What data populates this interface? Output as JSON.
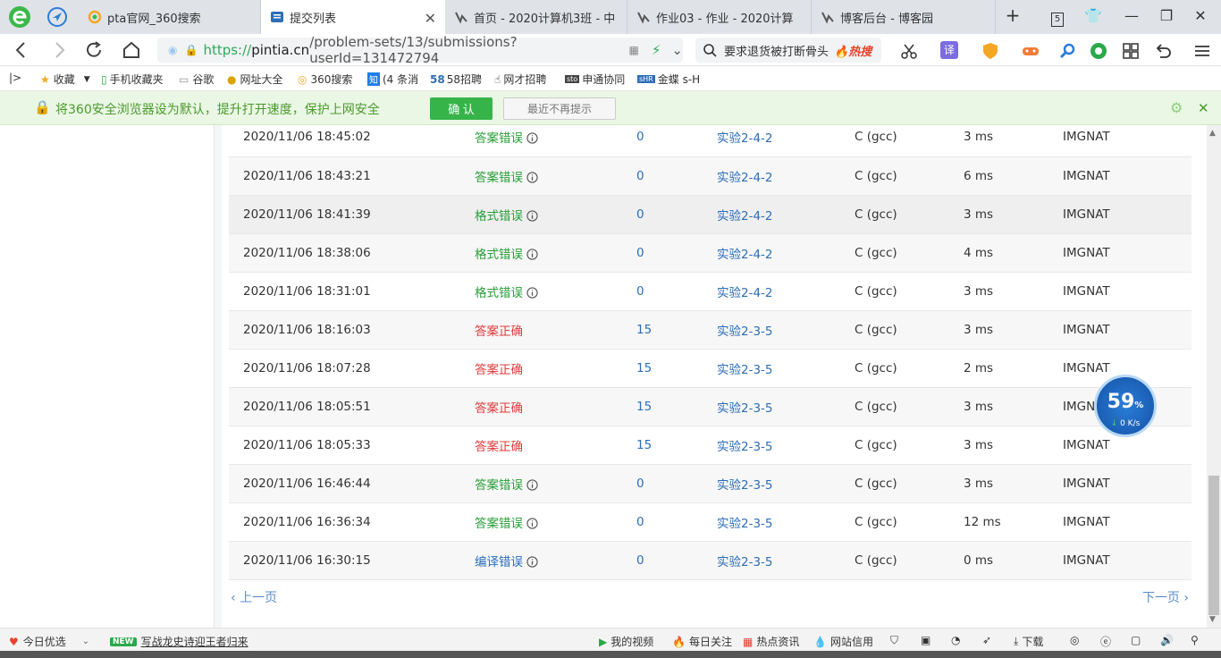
{
  "tabs": [
    {
      "title": "pta官网_360搜索",
      "active": false
    },
    {
      "title": "提交列表",
      "active": true
    },
    {
      "title": "首页 - 2020计算机3班 - 中",
      "active": false
    },
    {
      "title": "作业03 - 作业 - 2020计算",
      "active": false
    },
    {
      "title": "博客后台 - 博客园",
      "active": false
    }
  ],
  "tab_count": "5",
  "address": {
    "scheme": "https://",
    "host": "pintia.cn",
    "path": "/problem-sets/13/submissions?userId=131472794"
  },
  "search": {
    "text": "要求退货被打断骨头",
    "hot_label": "热搜"
  },
  "toolbar": {
    "translate_label": "译"
  },
  "bookmarks": [
    {
      "label": "收藏"
    },
    {
      "label": "手机收藏夹"
    },
    {
      "label": "谷歌"
    },
    {
      "label": "网址大全"
    },
    {
      "label": "360搜索"
    },
    {
      "label": "(4 条消"
    },
    {
      "label": "58招聘"
    },
    {
      "label": "网才招聘"
    },
    {
      "label": "申通协同"
    },
    {
      "label": "金蝶 s-H"
    }
  ],
  "notice": {
    "message": "将360安全浏览器设为默认，提升打开速度，保护上网安全",
    "confirm_label": "确 认",
    "dismiss_label": "最近不再提示"
  },
  "submissions": [
    {
      "time": "2020/11/06 18:45:02",
      "status": "答案错误",
      "status_kind": "wrong",
      "score": "0",
      "problem": "实验2-4-2",
      "compiler": "C (gcc)",
      "runtime": "3 ms",
      "user": "IMGNAT"
    },
    {
      "time": "2020/11/06 18:43:21",
      "status": "答案错误",
      "status_kind": "wrong",
      "score": "0",
      "problem": "实验2-4-2",
      "compiler": "C (gcc)",
      "runtime": "6 ms",
      "user": "IMGNAT"
    },
    {
      "time": "2020/11/06 18:41:39",
      "status": "格式错误",
      "status_kind": "format",
      "score": "0",
      "problem": "实验2-4-2",
      "compiler": "C (gcc)",
      "runtime": "3 ms",
      "user": "IMGNAT"
    },
    {
      "time": "2020/11/06 18:38:06",
      "status": "格式错误",
      "status_kind": "format",
      "score": "0",
      "problem": "实验2-4-2",
      "compiler": "C (gcc)",
      "runtime": "4 ms",
      "user": "IMGNAT"
    },
    {
      "time": "2020/11/06 18:31:01",
      "status": "格式错误",
      "status_kind": "format",
      "score": "0",
      "problem": "实验2-4-2",
      "compiler": "C (gcc)",
      "runtime": "3 ms",
      "user": "IMGNAT"
    },
    {
      "time": "2020/11/06 18:16:03",
      "status": "答案正确",
      "status_kind": "correct",
      "score": "15",
      "problem": "实验2-3-5",
      "compiler": "C (gcc)",
      "runtime": "3 ms",
      "user": "IMGNAT"
    },
    {
      "time": "2020/11/06 18:07:28",
      "status": "答案正确",
      "status_kind": "correct",
      "score": "15",
      "problem": "实验2-3-5",
      "compiler": "C (gcc)",
      "runtime": "2 ms",
      "user": "IMGNAT"
    },
    {
      "time": "2020/11/06 18:05:51",
      "status": "答案正确",
      "status_kind": "correct",
      "score": "15",
      "problem": "实验2-3-5",
      "compiler": "C (gcc)",
      "runtime": "3 ms",
      "user": "IMGNAT"
    },
    {
      "time": "2020/11/06 18:05:33",
      "status": "答案正确",
      "status_kind": "correct",
      "score": "15",
      "problem": "实验2-3-5",
      "compiler": "C (gcc)",
      "runtime": "3 ms",
      "user": "IMGNAT"
    },
    {
      "time": "2020/11/06 16:46:44",
      "status": "答案错误",
      "status_kind": "wrong",
      "score": "0",
      "problem": "实验2-3-5",
      "compiler": "C (gcc)",
      "runtime": "3 ms",
      "user": "IMGNAT"
    },
    {
      "time": "2020/11/06 16:36:34",
      "status": "答案错误",
      "status_kind": "wrong",
      "score": "0",
      "problem": "实验2-3-5",
      "compiler": "C (gcc)",
      "runtime": "12 ms",
      "user": "IMGNAT"
    },
    {
      "time": "2020/11/06 16:30:15",
      "status": "编译错误",
      "status_kind": "compile",
      "score": "0",
      "problem": "实验2-3-5",
      "compiler": "C (gcc)",
      "runtime": "0 ms",
      "user": "IMGNAT"
    }
  ],
  "pager": {
    "prev_label": "上一页",
    "next_label": "下一页"
  },
  "speed_widget": {
    "percent": "59",
    "percent_unit": "%",
    "rate": "0 K/s"
  },
  "statusbar": {
    "left": [
      {
        "label": "今日优选"
      },
      {
        "label": "写战龙史诗迎王者归来",
        "badge": "NEW"
      }
    ],
    "right": [
      {
        "label": "我的视频"
      },
      {
        "label": "每日关注"
      },
      {
        "label": "热点资讯"
      },
      {
        "label": "网站信用"
      },
      {
        "label": "下载"
      }
    ]
  },
  "colors": {
    "accent_green": "#37b449",
    "status_wrong": "#2a9d3a",
    "status_correct": "#e03b3b",
    "link_blue": "#2d6eb8"
  }
}
